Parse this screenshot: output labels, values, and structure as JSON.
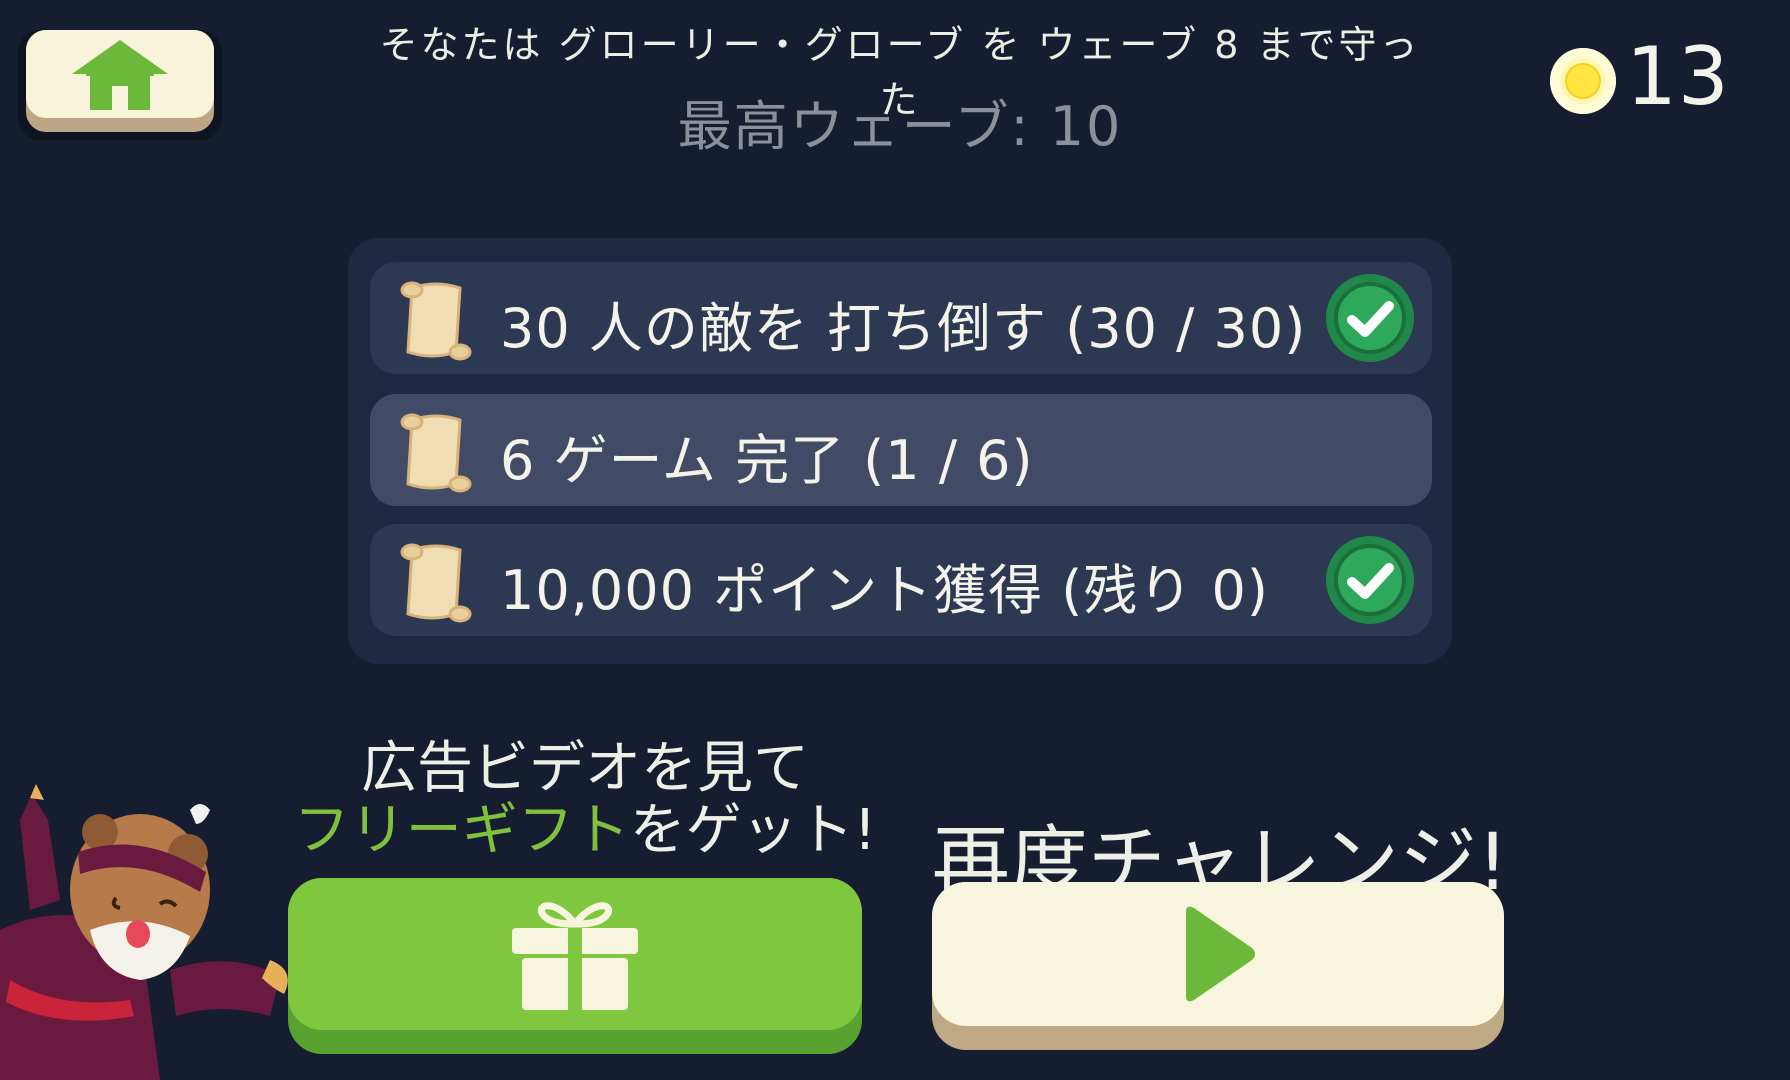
{
  "header": {
    "defended_text": "そなたは グローリー・グローブ を ウェーブ 8 まで守った",
    "best_wave_text": "最高ウェーブ: 10"
  },
  "currency": {
    "coins": "13"
  },
  "quests": [
    {
      "label": "30 人の敵を 打ち倒す (30 / 30)",
      "completed": true
    },
    {
      "label": "6 ゲーム 完了 (1 / 6)",
      "completed": false
    },
    {
      "label": "10,000 ポイント獲得 (残り 0)",
      "completed": true
    }
  ],
  "gift": {
    "line1": "広告ビデオを見て",
    "line2_accent": "フリーギフト",
    "line2_rest": "をゲット!"
  },
  "retry": {
    "title": "再度チャレンジ!"
  },
  "icons": {
    "home": "home-icon",
    "coin": "coin-icon",
    "scroll": "scroll-icon",
    "check": "check-circle-icon",
    "gift": "gift-icon",
    "play": "play-icon"
  },
  "colors": {
    "background": "#161d30",
    "panel": "#1f2941",
    "accent_green": "#7ec73f",
    "cream": "#f8f5df"
  }
}
